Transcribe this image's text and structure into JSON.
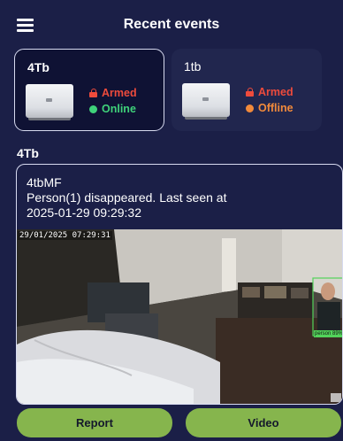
{
  "header": {
    "title": "Recent events",
    "menu_icon": "hamburger-menu-icon"
  },
  "devices": [
    {
      "name": "4Tb",
      "arm_status": "Armed",
      "conn_status": "Online",
      "conn_color": "#3fd27a",
      "selected": true
    },
    {
      "name": "1tb",
      "arm_status": "Armed",
      "conn_status": "Offline",
      "conn_color": "#f28a3b",
      "selected": false
    }
  ],
  "colors": {
    "background": "#1b1f47",
    "armed": "#ee4b3c",
    "button": "#86b54d"
  },
  "section": {
    "title": "4Tb"
  },
  "event": {
    "source": "4tbMF",
    "message": "Person(1) disappeared. Last seen at",
    "time": "2025-01-29 09:29:32",
    "overlay_timestamp": "29/01/2025 07:29:31",
    "detection_label": "person 89%"
  },
  "actions": {
    "report": "Report",
    "video": "Video"
  }
}
